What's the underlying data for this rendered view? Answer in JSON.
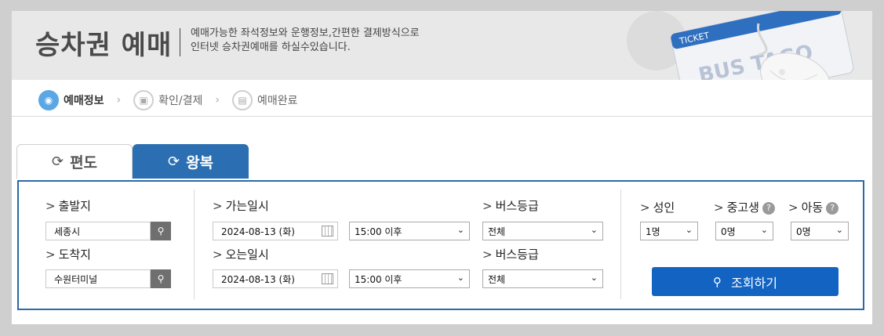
{
  "header": {
    "title": "승차권 예매",
    "desc_line1": "예매가능한 좌석정보와 운행정보,간편한 결제방식으로",
    "desc_line2": "인터넷 승차권예매를 하실수있습니다.",
    "ticket_label": "TICKET",
    "ticket_brand": "BUS TAGO"
  },
  "steps": [
    {
      "label": "예매정보",
      "icon": "location-pin-icon",
      "active": true
    },
    {
      "label": "확인/결제",
      "icon": "monitor-check-icon",
      "active": false
    },
    {
      "label": "예매완료",
      "icon": "document-icon",
      "active": false
    }
  ],
  "tabs": {
    "one_way": "편도",
    "round_trip": "왕복",
    "selected": "왕복"
  },
  "form": {
    "departure_label": "출발지",
    "departure_value": "세종시",
    "arrival_label": "도착지",
    "arrival_value": "수원터미널",
    "go_date_label": "가는일시",
    "go_date": "2024-08-13 (화)",
    "go_time": "15:00 이후",
    "return_date_label": "오는일시",
    "return_date": "2024-08-13 (화)",
    "return_time": "15:00 이후",
    "bus_grade_label": "버스등급",
    "bus_grade_go": "전체",
    "bus_grade_return": "전체",
    "adult_label": "성인",
    "adult_value": "1명",
    "student_label": "중고생",
    "student_value": "0명",
    "child_label": "아동",
    "child_value": "0명",
    "search_button": "조회하기"
  },
  "colors": {
    "accent": "#2b6fb2",
    "button": "#1363c3",
    "active_step": "#5aa7e6"
  }
}
